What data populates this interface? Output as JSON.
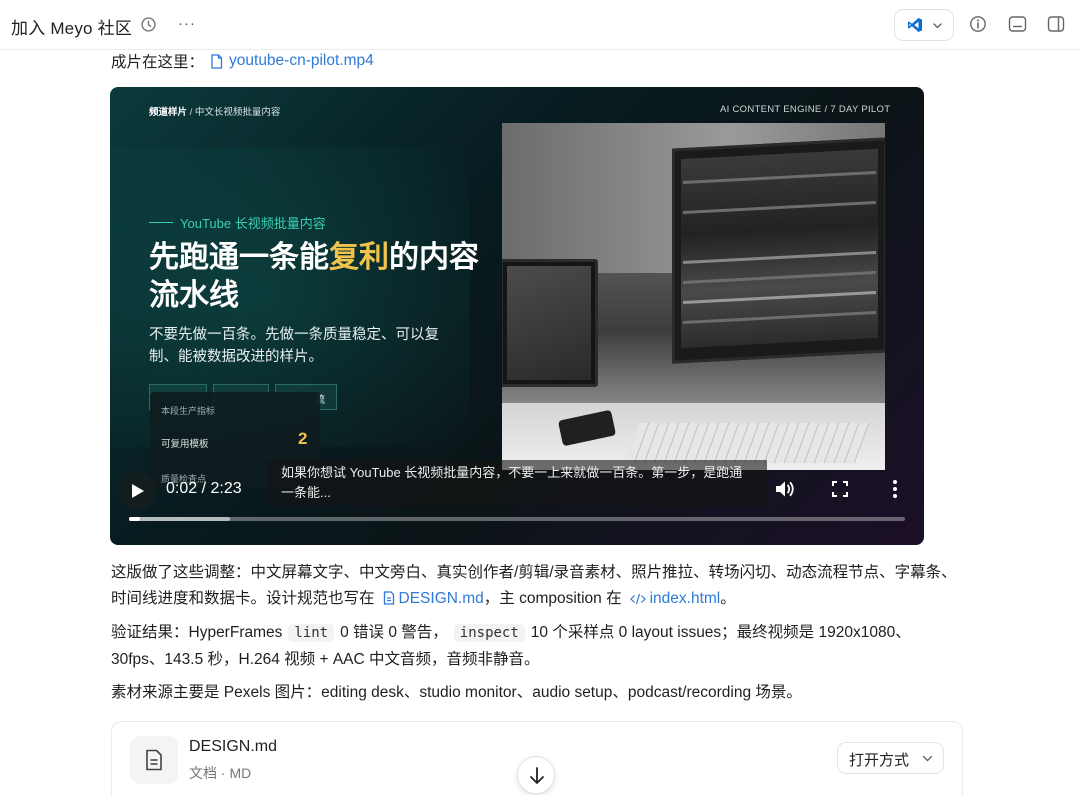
{
  "header": {
    "title": "加入 Meyo 社区",
    "more": "···"
  },
  "file_line": {
    "label": "成片在这里：",
    "file": "youtube-cn-pilot.mp4"
  },
  "video": {
    "top_left_bold": "频道样片",
    "top_left_rest": " / 中文长视频批量内容",
    "top_right": "AI CONTENT ENGINE / 7 DAY PILOT",
    "tag": "YouTube 长视频批量内容",
    "headline_a": "先跑通一条能",
    "headline_hl": "复利",
    "headline_b": "的内容流水线",
    "sub": "不要先做一百条。先做一条质量稳定、可以复制、能被数据改进的样片。",
    "card_k1": "本段生产指标",
    "card_k2": "可复用模板",
    "card_val": "2",
    "card_k3": "质量检查点",
    "tab_right": "流",
    "caption": "如果你想试 YouTube 长视频批量内容，不要一上来就做一百条。第一步，是跑通一条能...",
    "time_current": "0:02",
    "time_sep": " / ",
    "time_total": "2:23",
    "progress_played": 0.014,
    "progress_buffered": 0.13
  },
  "para1": {
    "text_a": "这版做了这些调整：中文屏幕文字、中文旁白、真实创作者/剪辑/录音素材、照片推拉、转场闪切、动态流程节点、字幕条、时间线进度和数据卡。设计规范也写在",
    "link1": "DESIGN.md",
    "text_b": "，主 composition 在",
    "link2": "index.html",
    "text_c": "。"
  },
  "para2": {
    "text_a": "验证结果：HyperFrames",
    "code1": "lint",
    "text_b": "0 错误 0 警告，",
    "code2": "inspect",
    "text_c": "10 个采样点 0 layout issues；最终视频是 1920x1080、30fps、143.5 秒，H.264 视频 + AAC 中文音频，音频非静音。"
  },
  "para3": {
    "text": "素材来源主要是 Pexels 图片：editing desk、studio monitor、audio setup、podcast/recording 场景。"
  },
  "attachment": {
    "name": "DESIGN.md",
    "meta": "文档 · MD",
    "open_label": "打开方式"
  },
  "colors": {
    "link": "#2f7ad6",
    "accent_teal": "#37d0b0",
    "highlight": "#f2c34b",
    "vscode_blue": "#0a6fd0"
  },
  "icons": [
    "clock-icon",
    "more-icon",
    "vscode-icon",
    "chevron-down-icon",
    "info-icon",
    "panel-bottom-icon",
    "sidebar-icon",
    "file-icon",
    "play-icon",
    "volume-icon",
    "fullscreen-icon",
    "vertical-more-icon",
    "code-icon",
    "arrow-down-icon"
  ]
}
